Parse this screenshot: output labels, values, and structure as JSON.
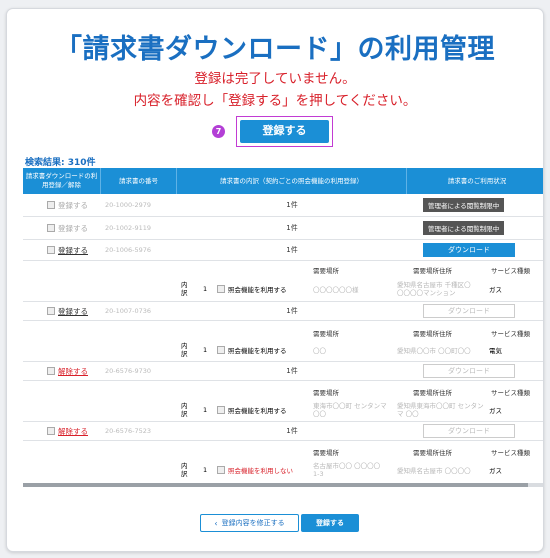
{
  "title": "「請求書ダウンロード」の利用管理",
  "warning_line1": "登録は完了していません。",
  "warning_line2": "内容を確認し「登録する」を押してください。",
  "step_number": "7",
  "top_button_label": "登録する",
  "result_count": "検索結果: 310件",
  "headers": {
    "col1": "請求書ダウンロードの利用登録／解除",
    "col2": "請求書の番号",
    "col3": "請求書の内訳（契約ごとの照会機能の利用登録）",
    "col4": "請求書のご利用状況"
  },
  "sub_headers": {
    "place": "需要場所",
    "address": "需要場所住所",
    "service": "サービス種類"
  },
  "rows": [
    {
      "action": "登録する",
      "bill_no": "20-1000-2979",
      "count": "1件",
      "status": "管理者による閲覧制限中"
    },
    {
      "action": "登録する",
      "bill_no": "20-1002-9119",
      "count": "1件",
      "status": "管理者による閲覧制限中"
    },
    {
      "action": "登録する",
      "bill_no": "20-1006-5976",
      "count": "1件",
      "status": "ダウンロード",
      "detail": {
        "label1": "内",
        "label2": "訳",
        "num": "1",
        "check": "照会機能を利用する",
        "place": "〇〇〇〇〇〇様",
        "address": "愛知県名古屋市 千種区〇〇〇〇〇マンション",
        "service": "ガス"
      }
    },
    {
      "action": "登録する",
      "bill_no": "20-1007-0736",
      "count": "1件",
      "status": "ダウンロード",
      "detail": {
        "label1": "内",
        "label2": "訳",
        "num": "1",
        "check": "照会機能を利用する",
        "place": "〇〇",
        "address": "愛知県〇〇市 〇〇町〇〇",
        "service": "電気"
      }
    },
    {
      "action": "解除する",
      "bill_no": "20-6576-9730",
      "count": "1件",
      "status": "ダウンロード",
      "detail": {
        "label1": "内",
        "label2": "訳",
        "num": "1",
        "check": "照会機能を利用する",
        "place": "東海市〇〇町 センタンマ 〇〇",
        "address": "愛知県東海市〇〇町 センタンマ 〇〇",
        "service": "ガス"
      }
    },
    {
      "action": "解除する",
      "bill_no": "20-6576-7523",
      "count": "1件",
      "status": "ダウンロード",
      "detail": {
        "label1": "内",
        "label2": "訳",
        "num": "1",
        "check": "照会機能を利用しない",
        "place": "名古屋市〇〇 〇〇〇〇 1-3",
        "address": "愛知県名古屋市 〇〇〇〇",
        "service": "ガス"
      }
    }
  ],
  "back_button_label": "登録内容を修正する",
  "bottom_button_label": "登録する",
  "colors": {
    "accent": "#1b8fd6",
    "warning": "#d8202a",
    "highlight": "#c23bd3"
  }
}
